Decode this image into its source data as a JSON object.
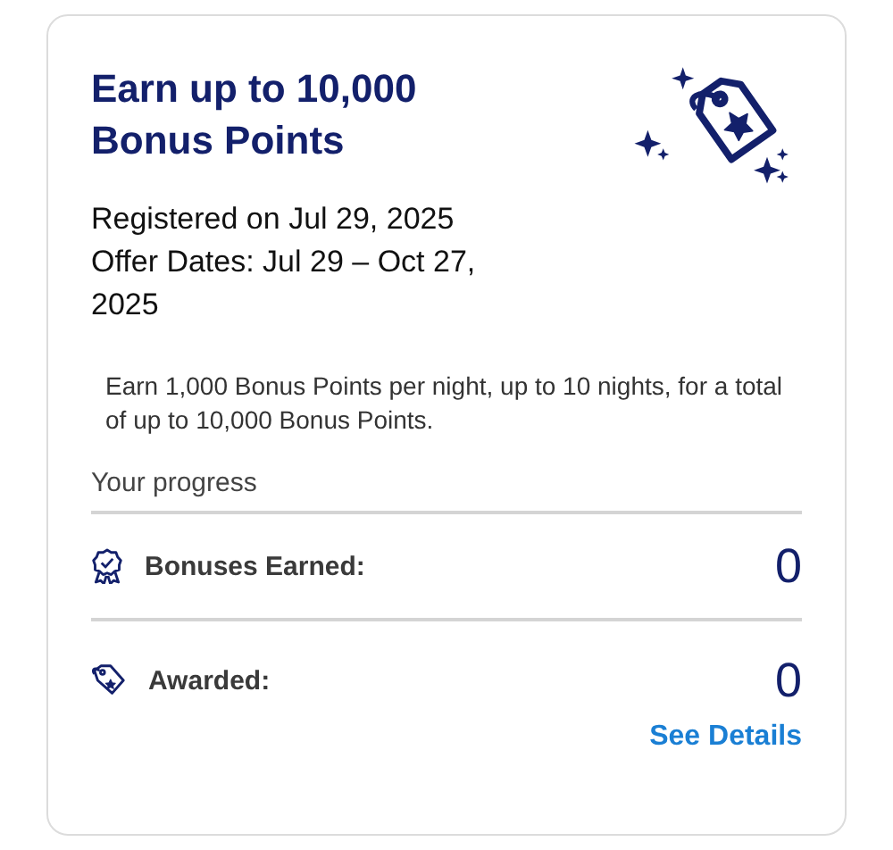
{
  "offer": {
    "title": "Earn up to 10,000 Bonus Points",
    "registered": "Registered on Jul 29, 2025",
    "dates": "Offer Dates: Jul 29 – Oct 27, 2025",
    "description": "Earn 1,000 Bonus Points per night, up to 10 nights, for a total of up to 10,000 Bonus Points."
  },
  "progress": {
    "heading": "Your progress",
    "rows": [
      {
        "kind": "earned",
        "label": "Bonuses Earned:",
        "value": "0"
      },
      {
        "kind": "awarded",
        "label": "Awarded:",
        "value": "0"
      }
    ]
  },
  "link": "See Details"
}
